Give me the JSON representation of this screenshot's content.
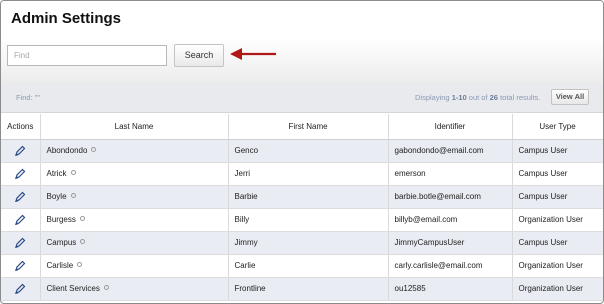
{
  "page": {
    "title": "Admin Settings"
  },
  "search": {
    "placeholder": "Find",
    "value": "",
    "button_label": "Search"
  },
  "results": {
    "find_label": "Find: \"\"",
    "display_prefix": "Displaying ",
    "range": "1-10",
    "out_of": " out of ",
    "total": "26",
    "suffix": " total results.",
    "view_all_label": "View All"
  },
  "table": {
    "columns": [
      "Actions",
      "Last Name",
      "First Name",
      "Identifier",
      "User Type"
    ],
    "rows": [
      {
        "last_name": "Abondondo",
        "first_name": "Genco",
        "identifier": "gabondondo@email.com",
        "user_type": "Campus User"
      },
      {
        "last_name": "Atrick",
        "first_name": "Jerri",
        "identifier": "emerson",
        "user_type": "Campus User"
      },
      {
        "last_name": "Boyle",
        "first_name": "Barbie",
        "identifier": "barbie.botle@email.com",
        "user_type": "Campus User"
      },
      {
        "last_name": "Burgess",
        "first_name": "Billy",
        "identifier": "billyb@email.com",
        "user_type": "Organization User"
      },
      {
        "last_name": "Campus",
        "first_name": "Jimmy",
        "identifier": "JimmyCampusUser",
        "user_type": "Campus User"
      },
      {
        "last_name": "Carlisle",
        "first_name": "Carlie",
        "identifier": "carly.carlisle@email.com",
        "user_type": "Organization User"
      },
      {
        "last_name": "Client Services",
        "first_name": "Frontline",
        "identifier": "ou12585",
        "user_type": "Organization User"
      }
    ]
  },
  "colors": {
    "arrow": "#b01818",
    "edit_icon": "#2c4c86",
    "row_alt": "#e9ecf2",
    "info_text": "#8a9ab3"
  },
  "icons": {
    "edit": "pencil-icon",
    "info": "info-dot-icon",
    "pointer": "arrow-left-icon"
  }
}
